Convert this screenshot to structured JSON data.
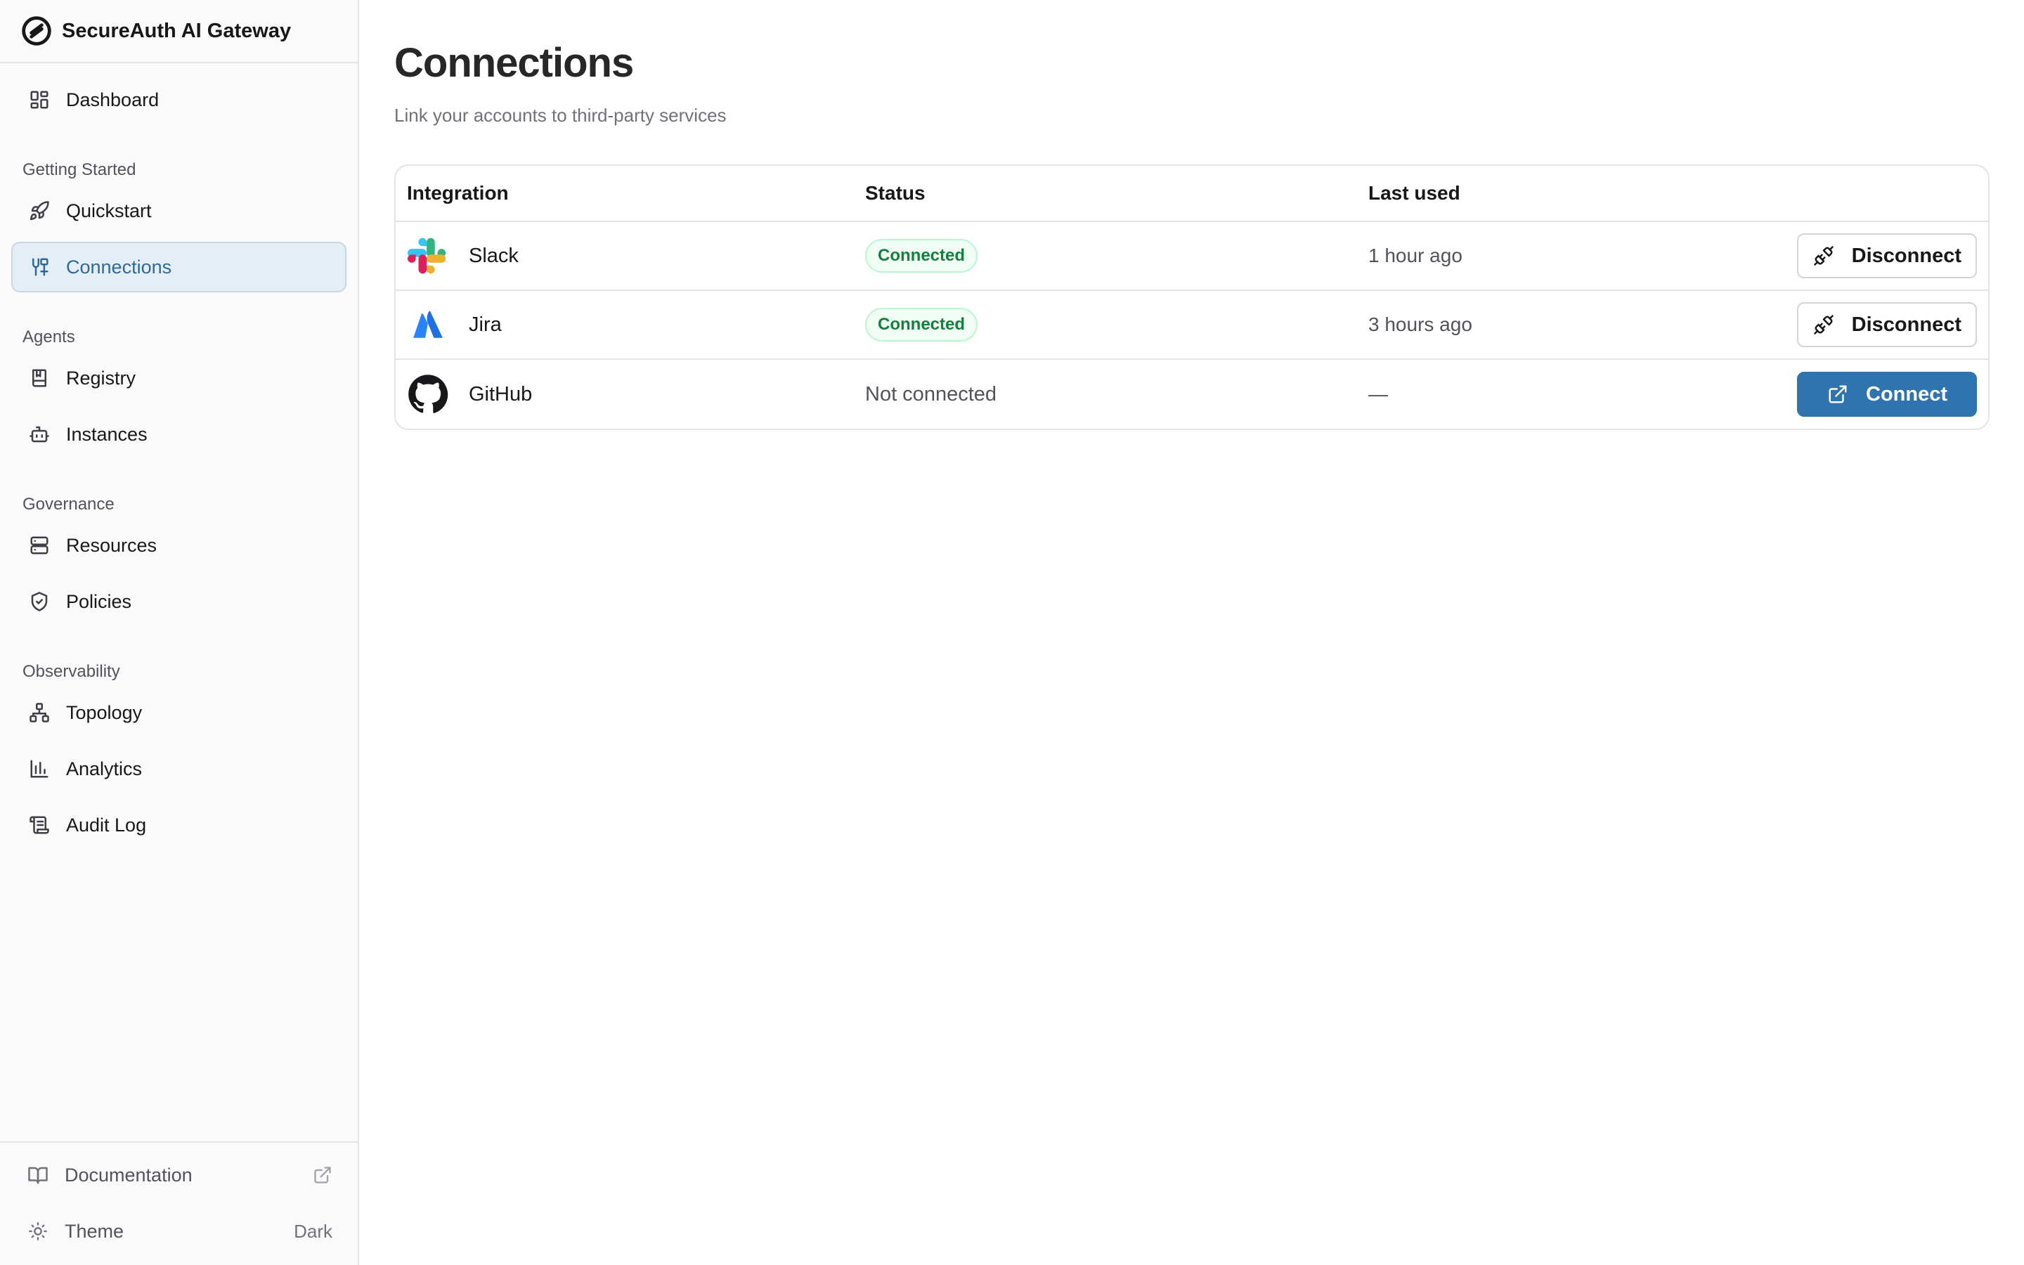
{
  "app": {
    "title": "SecureAuth AI Gateway"
  },
  "sidebar": {
    "dashboard": {
      "label": "Dashboard",
      "icon": "dashboard-icon"
    },
    "groups": [
      {
        "label": "Getting Started",
        "items": [
          {
            "label": "Quickstart",
            "icon": "rocket-icon"
          },
          {
            "label": "Connections",
            "icon": "connections-icon",
            "active": true
          }
        ]
      },
      {
        "label": "Agents",
        "items": [
          {
            "label": "Registry",
            "icon": "book-icon"
          },
          {
            "label": "Instances",
            "icon": "robot-icon"
          }
        ]
      },
      {
        "label": "Governance",
        "items": [
          {
            "label": "Resources",
            "icon": "server-icon"
          },
          {
            "label": "Policies",
            "icon": "shield-icon"
          }
        ]
      },
      {
        "label": "Observability",
        "items": [
          {
            "label": "Topology",
            "icon": "topology-icon"
          },
          {
            "label": "Analytics",
            "icon": "bar-chart-icon"
          },
          {
            "label": "Audit Log",
            "icon": "scroll-icon"
          }
        ]
      }
    ],
    "footer": {
      "documentation": {
        "label": "Documentation",
        "icon": "open-book-icon"
      },
      "theme": {
        "label": "Theme",
        "value": "Dark",
        "icon": "sun-icon"
      }
    }
  },
  "page": {
    "title": "Connections",
    "subtitle": "Link your accounts to third-party services"
  },
  "table": {
    "columns": [
      "Integration",
      "Status",
      "Last used"
    ],
    "rows": [
      {
        "name": "Slack",
        "logo": "slack-logo",
        "status": "Connected",
        "last_used": "1 hour ago",
        "action": "Disconnect"
      },
      {
        "name": "Jira",
        "logo": "jira-logo",
        "status": "Connected",
        "last_used": "3 hours ago",
        "action": "Disconnect"
      },
      {
        "name": "GitHub",
        "logo": "github-logo",
        "status": "Not connected",
        "last_used": "—",
        "action": "Connect"
      }
    ]
  },
  "colors": {
    "accent": "#2d74b1",
    "active_nav_bg": "#e6eef5",
    "connected_green": "#15803d"
  }
}
